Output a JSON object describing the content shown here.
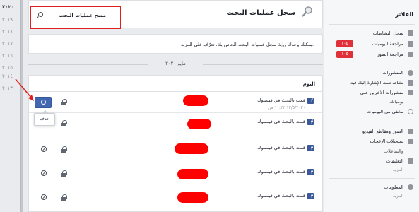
{
  "years": [
    "٢٠٢٠",
    "٢٠١٩",
    "٢٠١٨",
    "٢٠١٧",
    "٢٠١٦",
    "٢٠١٥",
    "٢٠١٤",
    "٢٠١٣"
  ],
  "header": {
    "title": "سجل عمليات البحث",
    "clear_label": "مسح عمليات البحث"
  },
  "info": {
    "text": "يمكنك وحدك رؤية سجل عمليات البحث الخاص بك. تعرّف على المزيد."
  },
  "month": "مايو ٢٠٢٠",
  "section_label": "اليوم",
  "rows": [
    {
      "text": "قمت بالبحث في فيسبوك",
      "time": "١٢/٥/٢٠٢٠ ١٠:٣٢ ص"
    },
    {
      "text": "قمت بالبحث في فيسبوك"
    },
    {
      "text": "قمت بالبحث في فيسبوك"
    },
    {
      "text": "قمت بالبحث في فيسبوك"
    },
    {
      "text": "قمت بالبحث في فيسبوك"
    }
  ],
  "tooltip": "حذف",
  "sidebar": {
    "title": "الفلاتر",
    "group1": [
      {
        "label": "سجل النشاطات",
        "icon": "activity-log-icon"
      },
      {
        "label": "مراجعة اليوميات",
        "icon": "timeline-review-icon",
        "badge": "١٠٥"
      },
      {
        "label": "مراجعة الصور",
        "icon": "photo-review-icon",
        "badge": "١٠٥"
      }
    ],
    "group2": [
      {
        "label": "المنشورات",
        "icon": "person-icon"
      },
      {
        "label": "نشاط تمت الإشارة إليك فيه",
        "icon": "tag-icon"
      },
      {
        "label": "منشورات الآخرين على",
        "icon": "comment-icon"
      },
      {
        "label": "يومياتك",
        "icon": ""
      },
      {
        "label": "مخفي من اليوميات",
        "icon": "hidden-icon"
      }
    ],
    "group3": [
      {
        "label": "الصور ومقاطع الفيديو",
        "icon": "photo-icon"
      },
      {
        "label": "تسجيلات الإعجاب",
        "icon": "like-icon"
      },
      {
        "label": "والتفاعلات",
        "icon": ""
      },
      {
        "label": "التعليقات",
        "icon": "comment-icon"
      },
      {
        "label": "المزيد",
        "icon": ""
      }
    ],
    "group4": [
      {
        "label": "المعلومات",
        "icon": "info-icon"
      },
      {
        "label": "المزيد",
        "icon": ""
      }
    ]
  }
}
